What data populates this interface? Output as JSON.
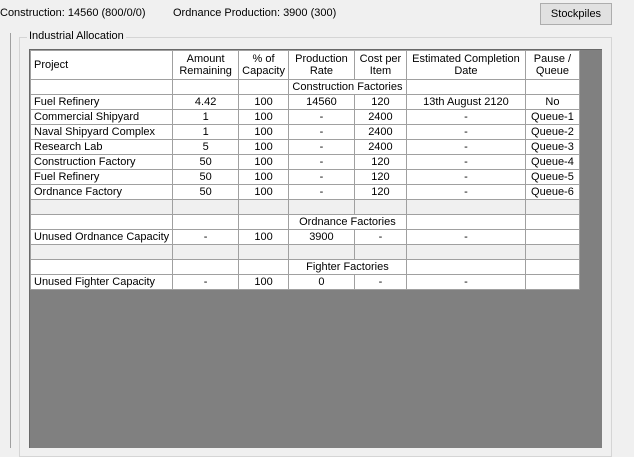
{
  "top": {
    "construction": "Construction: 14560  (800/0/0)",
    "ordnance": "Ordnance Production: 3900  (300)",
    "stockpiles_label": "Stockpiles"
  },
  "groupbox": {
    "label": "Industrial Allocation"
  },
  "table": {
    "headers": {
      "project": "Project",
      "amount": "Amount Remaining",
      "capacity": "% of Capacity",
      "production": "Production Rate",
      "cost": "Cost per Item",
      "completion": "Estimated Completion Date",
      "pause": "Pause / Queue"
    },
    "sections": {
      "construction": "Construction Factories",
      "ordnance": "Ordnance Factories",
      "fighter": "Fighter Factories"
    },
    "construction_rows": [
      [
        "Fuel Refinery",
        "4.42",
        "100",
        "14560",
        "120",
        "13th August 2120",
        "No"
      ],
      [
        "Commercial Shipyard",
        "1",
        "100",
        "-",
        "2400",
        "-",
        "Queue-1"
      ],
      [
        "Naval Shipyard Complex",
        "1",
        "100",
        "-",
        "2400",
        "-",
        "Queue-2"
      ],
      [
        "Research Lab",
        "5",
        "100",
        "-",
        "2400",
        "-",
        "Queue-3"
      ],
      [
        "Construction Factory",
        "50",
        "100",
        "-",
        "120",
        "-",
        "Queue-4"
      ],
      [
        "Fuel Refinery",
        "50",
        "100",
        "-",
        "120",
        "-",
        "Queue-5"
      ],
      [
        "Ordnance Factory",
        "50",
        "100",
        "-",
        "120",
        "-",
        "Queue-6"
      ]
    ],
    "ordnance_rows": [
      [
        "Unused Ordnance Capacity",
        "-",
        "100",
        "3900",
        "-",
        "-",
        ""
      ]
    ],
    "fighter_rows": [
      [
        "Unused Fighter Capacity",
        "-",
        "100",
        "0",
        "-",
        "-",
        ""
      ]
    ]
  }
}
